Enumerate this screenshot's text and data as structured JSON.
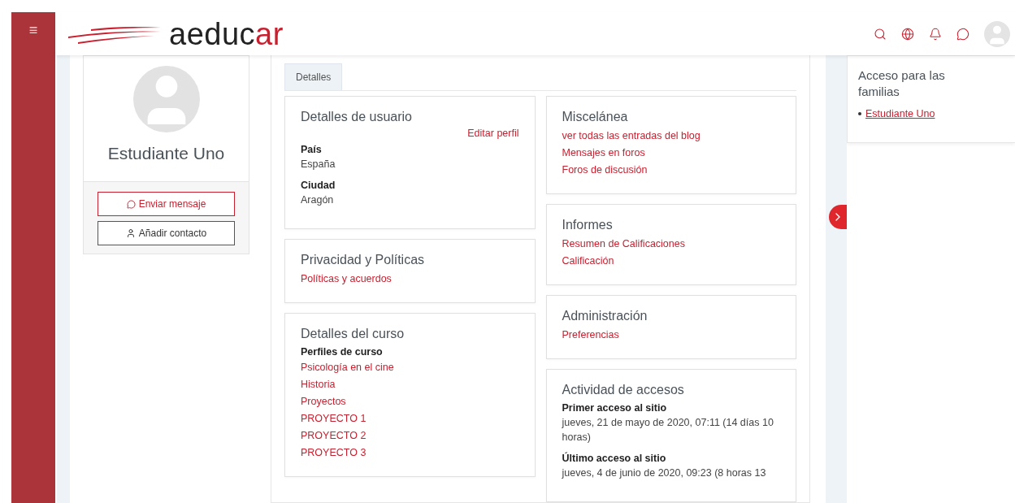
{
  "menu_glyph": "≡",
  "logo": {
    "main": "aeduc",
    "accent": "ar"
  },
  "profile": {
    "name": "Estudiante Uno",
    "buttons": [
      {
        "kind": "message",
        "label": "Enviar mensaje"
      },
      {
        "kind": "contact",
        "label": "Añadir contacto"
      }
    ]
  },
  "tabs": [
    {
      "label": "Detalles",
      "selected": true
    }
  ],
  "left_cards": [
    {
      "title": "Detalles de usuario",
      "action": "Editar perfil",
      "items": [
        {
          "kind": "field",
          "label": "País",
          "value": "España"
        },
        {
          "kind": "field",
          "label": "Ciudad",
          "value": "Aragón"
        }
      ]
    },
    {
      "title": "Privacidad y Políticas",
      "items": [
        {
          "kind": "link",
          "text": "Políticas y acuerdos"
        }
      ]
    },
    {
      "title": "Detalles del curso",
      "items": [
        {
          "kind": "heading",
          "text": "Perfiles de curso"
        },
        {
          "kind": "link",
          "text": "Psicología en el cine"
        },
        {
          "kind": "link",
          "text": "Historia"
        },
        {
          "kind": "link",
          "text": "Proyectos"
        },
        {
          "kind": "link",
          "text": "PROYECTO 1"
        },
        {
          "kind": "link",
          "text": "PROYECTO 2"
        },
        {
          "kind": "link",
          "text": "PROYECTO 3"
        }
      ]
    }
  ],
  "right_cards": [
    {
      "title": "Miscelánea",
      "items": [
        {
          "kind": "link",
          "text": "ver todas las entradas del blog"
        },
        {
          "kind": "link",
          "text": "Mensajes en foros"
        },
        {
          "kind": "link",
          "text": "Foros de discusión"
        }
      ]
    },
    {
      "title": "Informes",
      "items": [
        {
          "kind": "link",
          "text": "Resumen de Calificaciones"
        },
        {
          "kind": "link",
          "text": "Calificación"
        }
      ]
    },
    {
      "title": "Administración",
      "items": [
        {
          "kind": "link",
          "text": "Preferencias"
        }
      ]
    },
    {
      "title": "Actividad de accesos",
      "items": [
        {
          "kind": "field",
          "label": "Primer acceso al sitio",
          "value": "jueves, 21 de mayo de 2020, 07:11  (14 días 10 horas)"
        },
        {
          "kind": "field",
          "label": "Último acceso al sitio",
          "value": "jueves, 4 de junio de 2020, 09:23  (8 horas 13"
        }
      ]
    }
  ],
  "side_block": {
    "title": "Acceso para las familias",
    "links": [
      "Estudiante Uno"
    ]
  }
}
